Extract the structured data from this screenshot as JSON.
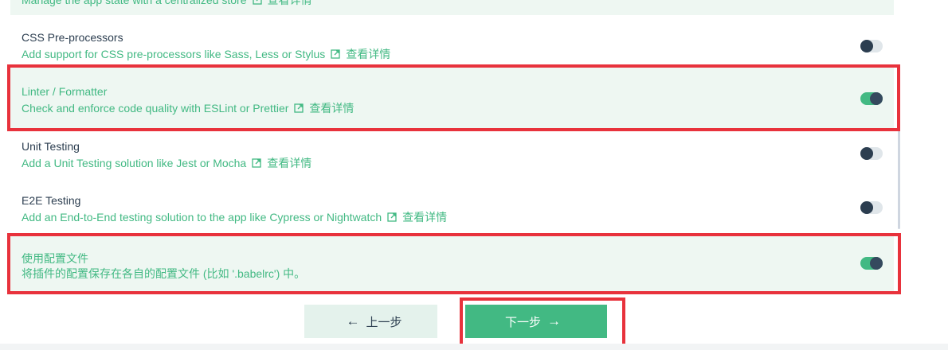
{
  "features": [
    {
      "name": "",
      "description": "Manage the app state with a centralized store",
      "more_link": "查看详情",
      "selected": true
    },
    {
      "name": "CSS Pre-processors",
      "description": "Add support for CSS pre-processors like Sass, Less or Stylus",
      "more_link": "查看详情",
      "selected": false
    },
    {
      "name": "Linter / Formatter",
      "description": "Check and enforce code quality with ESLint or Prettier",
      "more_link": "查看详情",
      "selected": true
    },
    {
      "name": "Unit Testing",
      "description": "Add a Unit Testing solution like Jest or Mocha",
      "more_link": "查看详情",
      "selected": false
    },
    {
      "name": "E2E Testing",
      "description": "Add an End-to-End testing solution to the app like Cypress or Nightwatch",
      "more_link": "查看详情",
      "selected": false
    },
    {
      "name": "使用配置文件",
      "description": "将插件的配置保存在各自的配置文件 (比如 '.babelrc') 中。",
      "more_link": "",
      "selected": true
    }
  ],
  "buttons": {
    "prev_label": "上一步",
    "next_label": "下一步",
    "prev_arrow": "←",
    "next_arrow": "→"
  },
  "icons": {
    "external_link": "external-link-icon"
  },
  "colors": {
    "accent": "#42b983",
    "highlight": "#e8323c",
    "dark": "#2c3e50",
    "selected_bg": "#eef7f2"
  }
}
